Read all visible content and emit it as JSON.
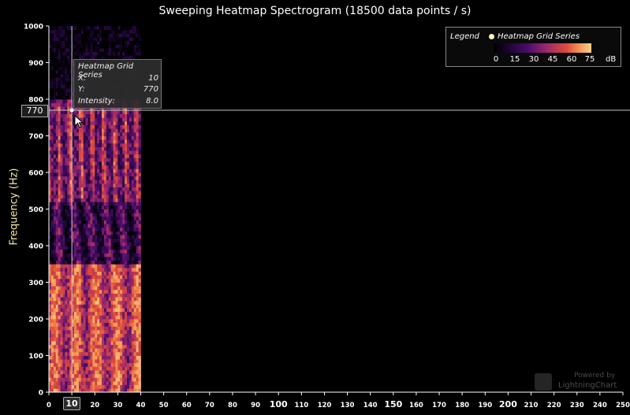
{
  "chart_data": {
    "type": "heatmap",
    "title": "Sweeping Heatmap Spectrogram (18500 data points / s)",
    "ylabel": "Frequency (Hz)",
    "xlabel": "",
    "xlim": [
      0,
      250
    ],
    "ylim": [
      0,
      1000
    ],
    "x_ticks": [
      "0",
      "10",
      "20",
      "30",
      "40",
      "50",
      "60",
      "70",
      "80",
      "90",
      "100",
      "110",
      "120",
      "130",
      "140",
      "150",
      "160",
      "170",
      "180",
      "190",
      "200",
      "210",
      "220",
      "230",
      "240",
      "250"
    ],
    "y_ticks": [
      "0",
      "100",
      "200",
      "300",
      "400",
      "500",
      "600",
      "700",
      "800",
      "900",
      "1000"
    ],
    "grid": false,
    "filled_x_range": [
      0,
      40
    ],
    "colormap": {
      "unit": "dB",
      "min": 0,
      "max": 75,
      "stops": [
        "#000000",
        "#1a0630",
        "#4a0c6b",
        "#9e2a6c",
        "#e04c3a",
        "#f6a35a",
        "#f8d28f"
      ]
    },
    "legend": {
      "title": "Legend",
      "series_name": "Heatmap Grid Series",
      "ticks": [
        "0",
        "15",
        "30",
        "45",
        "60",
        "75"
      ],
      "unit": "dB",
      "placement": "top-right"
    },
    "cursor": {
      "series_name": "Heatmap Grid Series",
      "x_label": "X:",
      "x_value": "10",
      "y_label": "Y:",
      "y_value": "770",
      "intensity_label": "Intensity:",
      "intensity_value": "8.0",
      "x": 10,
      "y": 770
    }
  },
  "watermark": {
    "line1": "Powered by",
    "line2": "LightningChart"
  },
  "colors": {
    "background": "#000000",
    "axis": "#ffffff",
    "ylabel": "#f5e9a8",
    "crosshair": "#c8c8c8"
  }
}
